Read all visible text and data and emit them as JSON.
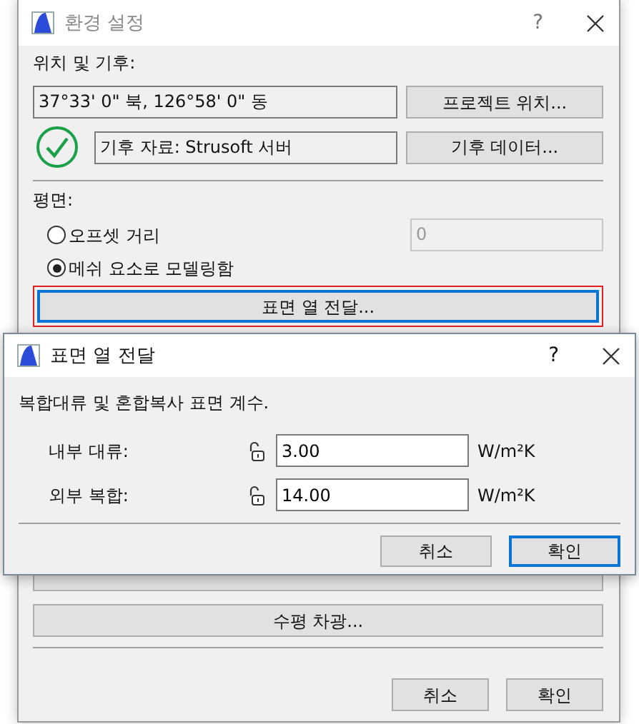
{
  "main_window": {
    "title": "환경 설정",
    "help": "?",
    "location_heading": "위치 및 기후:",
    "coordinates": "37°33' 0\" 북, 126°58' 0\" 동",
    "project_location_button": "프로젝트 위치...",
    "climate_source": "기후 자료: Strusoft 서버",
    "climate_data_button": "기후 데이터...",
    "plan_heading": "평면:",
    "options": [
      {
        "label": "오프셋 거리",
        "selected": false
      },
      {
        "label": "메쉬 요소로 모델링함",
        "selected": true
      }
    ],
    "offset_field": {
      "value": "0",
      "disabled": true
    },
    "surface_heat_button": {
      "label": "표면 열 전달...",
      "highlighted": true
    },
    "shading_button": "수평 차광...",
    "buttons": [
      "취소",
      "확인"
    ]
  },
  "dialog": {
    "title": "표면 열 전달",
    "help": "?",
    "description": "복합대류 및 혼합복사 표면 계수.",
    "fields": [
      {
        "label": "내부 대류:",
        "locked": false,
        "value": "3.00",
        "unit": "W/m²K"
      },
      {
        "label": "외부 복합:",
        "locked": false,
        "value": "14.00",
        "unit": "W/m²K"
      }
    ],
    "buttons": [
      {
        "label": "취소",
        "default": false
      },
      {
        "label": "확인",
        "default": true
      }
    ]
  }
}
